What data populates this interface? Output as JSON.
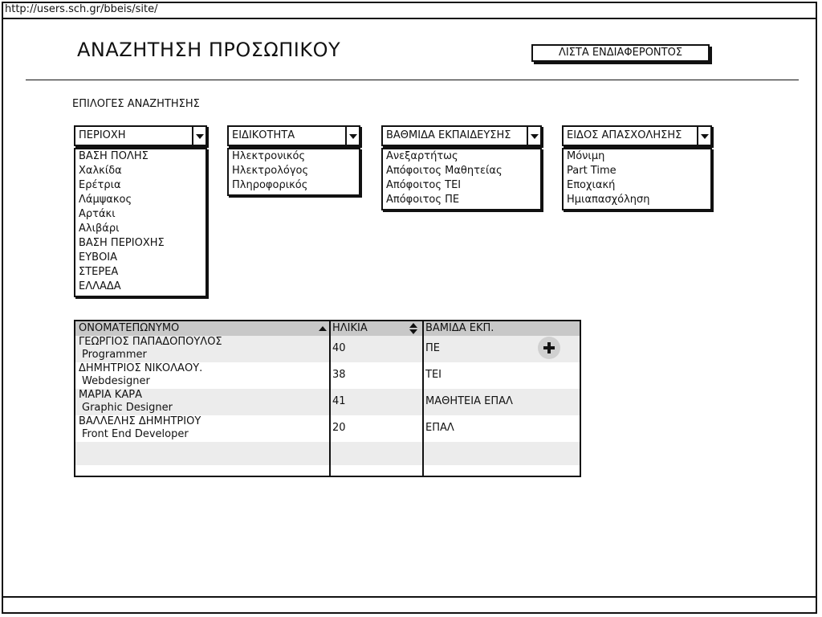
{
  "browser": {
    "url": "http://users.sch.gr/bbeis/site/"
  },
  "header": {
    "title": "ΑΝΑΖΗΤΗΣΗ ΠΡΟΣΩΠΙΚΟΥ",
    "interest_list_button": "ΛΙΣΤΑ ΕΝΔΙΑΦΕΡΟΝΤΟΣ"
  },
  "search": {
    "section_label": "ΕΠΙΛΟΓΕΣ ΑΝΑΖΗΤΗΣΗΣ",
    "filters": [
      {
        "label": "ΠΕΡΙΟΧΗ",
        "options": [
          "ΒΑΣΗ ΠΟΛΗΣ",
          "Χαλκίδα",
          "Ερέτρια",
          "Λάμψακος",
          "Αρτάκι",
          "Αλιβάρι",
          "ΒΑΣΗ ΠΕΡΙΟΧΗΣ",
          "ΕΥΒΟΙΑ",
          "ΣΤΕΡΕΑ",
          "ΕΛΛΑΔΑ"
        ]
      },
      {
        "label": "ΕΙΔΙΚΟΤΗΤΑ",
        "options": [
          "Ηλεκτρονικός",
          "Ηλεκτρολόγος",
          "Πληροφορικός"
        ]
      },
      {
        "label": "ΒΑΘΜΙΔΑ ΕΚΠΑΙΔΕΥΣΗΣ",
        "options": [
          "Ανεξαρτήτως",
          "Απόφοιτος Μαθητείας",
          "Απόφοιτος ΤΕΙ",
          "Απόφοιτος ΠΕ"
        ]
      },
      {
        "label": "ΕΙΔΟΣ ΑΠΑΣΧΟΛΗΣΗΣ",
        "options": [
          "Μόνιμη",
          "Part Time",
          "Εποχιακή",
          "Ημιαπασχόληση"
        ]
      }
    ]
  },
  "results": {
    "columns": [
      "ΟΝΟΜΑΤΕΠΩΝΥΜΟ",
      "ΗΛΙΚΙΑ",
      "ΒΑΜΙΔΑ ΕΚΠ."
    ],
    "rows": [
      {
        "name": "ΓΕΩΡΓΙΟΣ ΠΑΠΑΔΟΠΟΥΛΟΣ",
        "role": "Programmer",
        "age": "40",
        "education": "ΠΕ"
      },
      {
        "name": "ΔΗΜΗΤΡΙΟΣ ΝΙΚΟΛΑΟΥ.",
        "role": "Webdesigner",
        "age": "38",
        "education": "ΤΕΙ"
      },
      {
        "name": "ΜΑΡΙΑ ΚΑΡΑ",
        "role": "Graphic Designer",
        "age": "41",
        "education": "ΜΑΘΗΤΕΙΑ ΕΠΑΛ"
      },
      {
        "name": "ΒΑΛΛΕΛΗΣ ΔΗΜΗΤΡΙΟΥ",
        "role": "Front End Developer",
        "age": "20",
        "education": "ΕΠΑΛ"
      }
    ],
    "add_icon": "plus-icon",
    "sort": {
      "name_column": "ascending",
      "age_column": "sortable"
    }
  }
}
